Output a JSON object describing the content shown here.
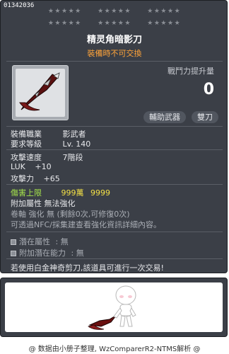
{
  "item_id": "01342036",
  "stars_row1": [
    "★★★★★",
    "★★★★★",
    "★★★★★"
  ],
  "stars_row2": [
    "★★★★★",
    "★★★★★",
    "★★★★★"
  ],
  "item_name": "精灵角暗影刀",
  "trade_note": "裝備時不可交換",
  "power_label": "戰鬥力提升量",
  "power_value": "0",
  "chips": [
    "輔助武器",
    "雙刀"
  ],
  "job_label": "裝備職業",
  "job_value": "影武者",
  "req_level_label": "要求等級",
  "req_level_value": "Lv. 140",
  "attack_speed_label": "攻擊速度",
  "attack_speed_value": "7階段",
  "luk_label": "LUK",
  "luk_value": "+10",
  "attack_label": "攻擊力",
  "attack_value": "+65",
  "damage_cap_label": "傷害上限",
  "damage_cap_value": "999萬",
  "damage_cap_num": "9999",
  "extra_attr": "附加屬性  無法強化",
  "scroll_line": "卷軸 強化 無 (剩餘0次,可修復0次)",
  "nfc_line": "可透過NFC/採集建查看強化資訊詳細內容。",
  "potential_label": "潛在屬性",
  "potential_value": ": 無",
  "add_potential_label": "附加潛在能力",
  "add_potential_value": ": 無",
  "platinum_note": "若使用白金神奇剪刀,該道具可進行一次交易!",
  "footer": "@ 数据由小册子整理, WzComparerR2-NTMS解析 @",
  "colors": {
    "panel": "#3b3f47",
    "trade_note": "#ffa43a",
    "green": "#a5e34b",
    "yellow": "#f3e046"
  },
  "icons": {
    "item": "dual-blade-icon",
    "preview": "character-preview"
  }
}
